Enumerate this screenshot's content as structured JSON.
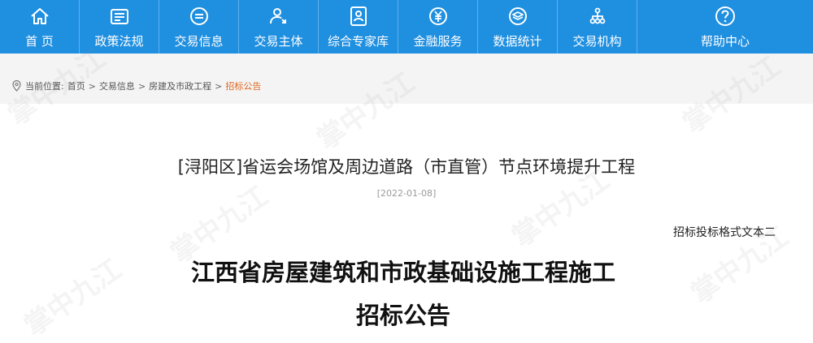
{
  "nav": {
    "items": [
      {
        "label": "首 页",
        "icon": "home-icon"
      },
      {
        "label": "政策法规",
        "icon": "document-icon"
      },
      {
        "label": "交易信息",
        "icon": "exchange-icon"
      },
      {
        "label": "交易主体",
        "icon": "user-icon"
      },
      {
        "label": "综合专家库",
        "icon": "expert-icon"
      },
      {
        "label": "金融服务",
        "icon": "yuan-icon"
      },
      {
        "label": "数据统计",
        "icon": "layers-icon"
      },
      {
        "label": "交易机构",
        "icon": "org-icon"
      },
      {
        "label": "帮助中心",
        "icon": "help-icon"
      }
    ],
    "bg_color": "#1f8fe0"
  },
  "breadcrumb": {
    "prefix": "当前位置:",
    "items": [
      "首页",
      "交易信息",
      "房建及市政工程"
    ],
    "separator": ">",
    "current": "招标公告"
  },
  "article": {
    "title": "[浔阳区]省运会场馆及周边道路（市直管）节点环境提升工程",
    "date": "[2022-01-08]",
    "format_note": "招标投标格式文本二",
    "heading_line1": "江西省房屋建筑和市政基础设施工程施工",
    "heading_line2": "招标公告"
  },
  "watermark": {
    "text": "掌中九江"
  }
}
